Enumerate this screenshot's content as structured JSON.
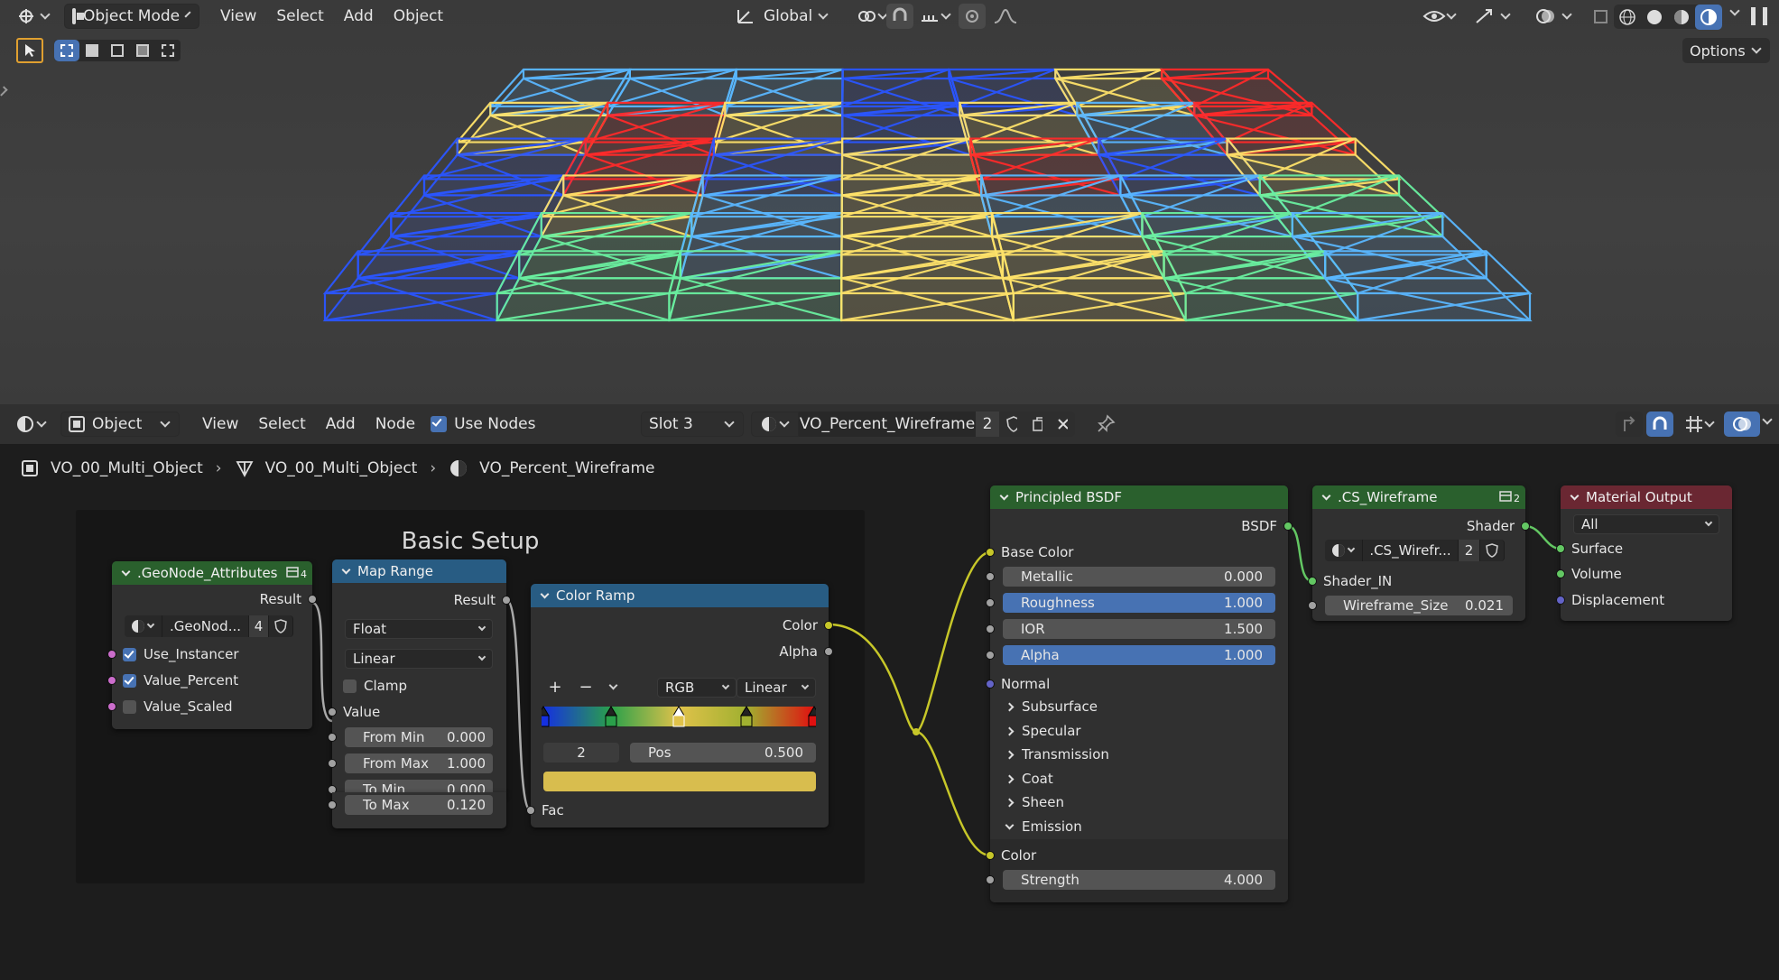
{
  "viewport_header": {
    "mode": "Object Mode",
    "menus": [
      "View",
      "Select",
      "Add",
      "Object"
    ],
    "transform_orientation": "Global",
    "options_label": "Options",
    "icons": [
      "editor-type-icon",
      "object-mode-icon",
      "orientation-icon",
      "pivot-icon",
      "snap-icon",
      "proportional-icon",
      "visibility-icon",
      "gizmo-icon",
      "overlay-icon",
      "xray-icon",
      "wireframe-shading-icon",
      "solid-shading-icon",
      "material-shading-icon",
      "rendered-shading-icon"
    ]
  },
  "node_header": {
    "editor": "Object",
    "menus": [
      "View",
      "Select",
      "Add",
      "Node"
    ],
    "use_nodes_label": "Use Nodes",
    "use_nodes_checked": true,
    "slot": "Slot 3",
    "material": "VO_Percent_Wireframe",
    "material_users": "2"
  },
  "breadcrumb": [
    "VO_00_Multi_Object",
    "VO_00_Multi_Object",
    "VO_Percent_Wireframe"
  ],
  "frame": {
    "label": "Basic Setup"
  },
  "nodes": {
    "geonode": {
      "title": ".GeoNode_Attributes",
      "users": "4",
      "result": "Result",
      "datablock": ".GeoNod...",
      "datablock_users": "4",
      "inputs": [
        {
          "label": "Use_Instancer",
          "checked": true
        },
        {
          "label": "Value_Percent",
          "checked": true
        },
        {
          "label": "Value_Scaled",
          "checked": false
        }
      ]
    },
    "map_range": {
      "title": "Map Range",
      "result": "Result",
      "data_type": "Float",
      "interpolation": "Linear",
      "clamp_label": "Clamp",
      "value_label": "Value",
      "fields": [
        {
          "label": "From Min",
          "value": "0.000"
        },
        {
          "label": "From Max",
          "value": "1.000"
        },
        {
          "label": "To Min",
          "value": "0.000"
        },
        {
          "label": "To Max",
          "value": "0.120"
        }
      ]
    },
    "color_ramp": {
      "title": "Color Ramp",
      "color_out": "Color",
      "alpha_out": "Alpha",
      "add": "+",
      "remove": "−",
      "color_mode": "RGB",
      "interpolation": "Linear",
      "index": "2",
      "pos_label": "Pos",
      "pos_value": "0.500",
      "fac_label": "Fac",
      "stops": [
        {
          "pos": 0.0,
          "color": "#1530e0"
        },
        {
          "pos": 0.25,
          "color": "#2aa04a"
        },
        {
          "pos": 0.5,
          "color": "#e0c24a"
        },
        {
          "pos": 0.75,
          "color": "#a0b030"
        },
        {
          "pos": 1.0,
          "color": "#e01010"
        }
      ],
      "active_color": "#d8bd4e"
    },
    "bsdf": {
      "title": "Principled BSDF",
      "output": "BSDF",
      "base_color": "Base Color",
      "fields": [
        {
          "label": "Metallic",
          "value": "0.000",
          "highlight": false
        },
        {
          "label": "Roughness",
          "value": "1.000",
          "highlight": true
        },
        {
          "label": "IOR",
          "value": "1.500",
          "highlight": false
        },
        {
          "label": "Alpha",
          "value": "1.000",
          "highlight": true
        }
      ],
      "normal": "Normal",
      "panels": [
        "Subsurface",
        "Specular",
        "Transmission",
        "Coat",
        "Sheen"
      ],
      "emission": "Emission",
      "emission_color": "Color",
      "strength_label": "Strength",
      "strength_value": "4.000"
    },
    "cs_wireframe": {
      "title": ".CS_Wireframe",
      "users": "2",
      "output": "Shader",
      "datablock": ".CS_Wirefr...",
      "datablock_users": "2",
      "shader_in": "Shader_IN",
      "size_label": "Wireframe_Size",
      "size_value": "0.021"
    },
    "material_output": {
      "title": "Material Output",
      "target": "All",
      "inputs": [
        "Surface",
        "Volume",
        "Displacement"
      ]
    }
  },
  "colors": {
    "accent": "#4772b3",
    "shader_socket": "#63c763",
    "color_socket": "#c7c729",
    "vector_socket": "#6363c7",
    "float_socket": "#a1a1a1"
  }
}
